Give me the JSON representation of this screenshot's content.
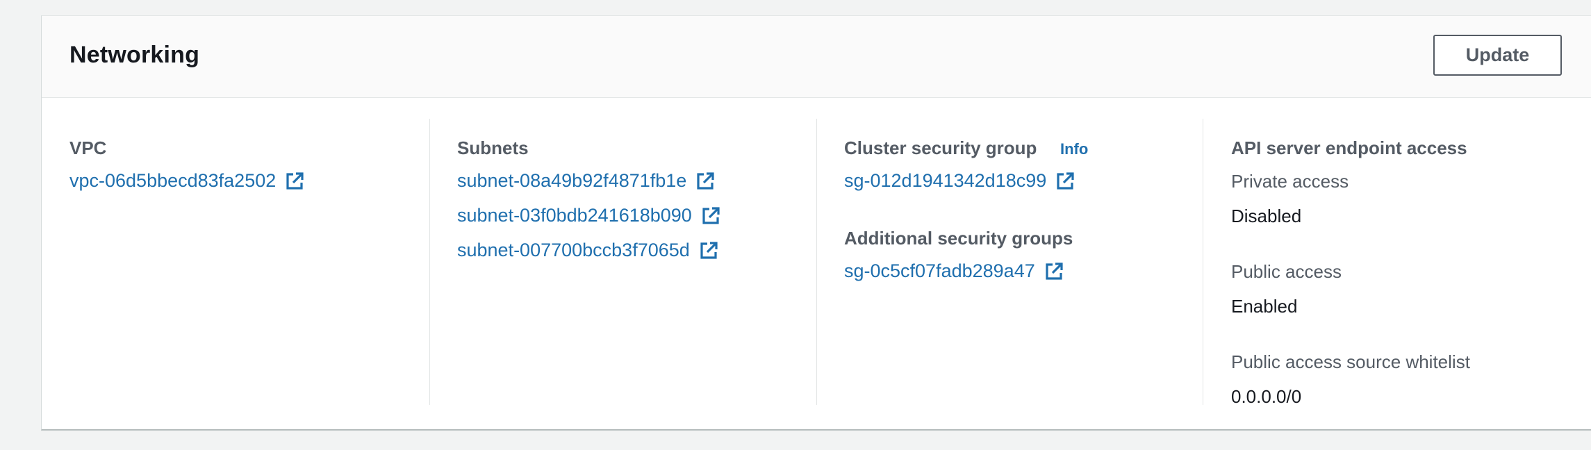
{
  "panel": {
    "title": "Networking",
    "update_label": "Update"
  },
  "vpc": {
    "label": "VPC",
    "value": "vpc-06d5bbecd83fa2502"
  },
  "subnets": {
    "label": "Subnets",
    "items": [
      "subnet-08a49b92f4871fb1e",
      "subnet-03f0bdb241618b090",
      "subnet-007700bccb3f7065d"
    ]
  },
  "security": {
    "cluster_label": "Cluster security group",
    "info_label": "Info",
    "cluster_value": "sg-012d1941342d18c99",
    "additional_label": "Additional security groups",
    "additional_value": "sg-0c5cf07fadb289a47"
  },
  "endpoint": {
    "label": "API server endpoint access",
    "private_label": "Private access",
    "private_value": "Disabled",
    "public_label": "Public access",
    "public_value": "Enabled",
    "whitelist_label": "Public access source whitelist",
    "whitelist_value": "0.0.0.0/0"
  },
  "icons": {
    "external_link": "external-link-icon"
  },
  "colors": {
    "link": "#1f6fae",
    "text": "#16191f",
    "label": "#545b64",
    "background": "#f2f3f3"
  }
}
